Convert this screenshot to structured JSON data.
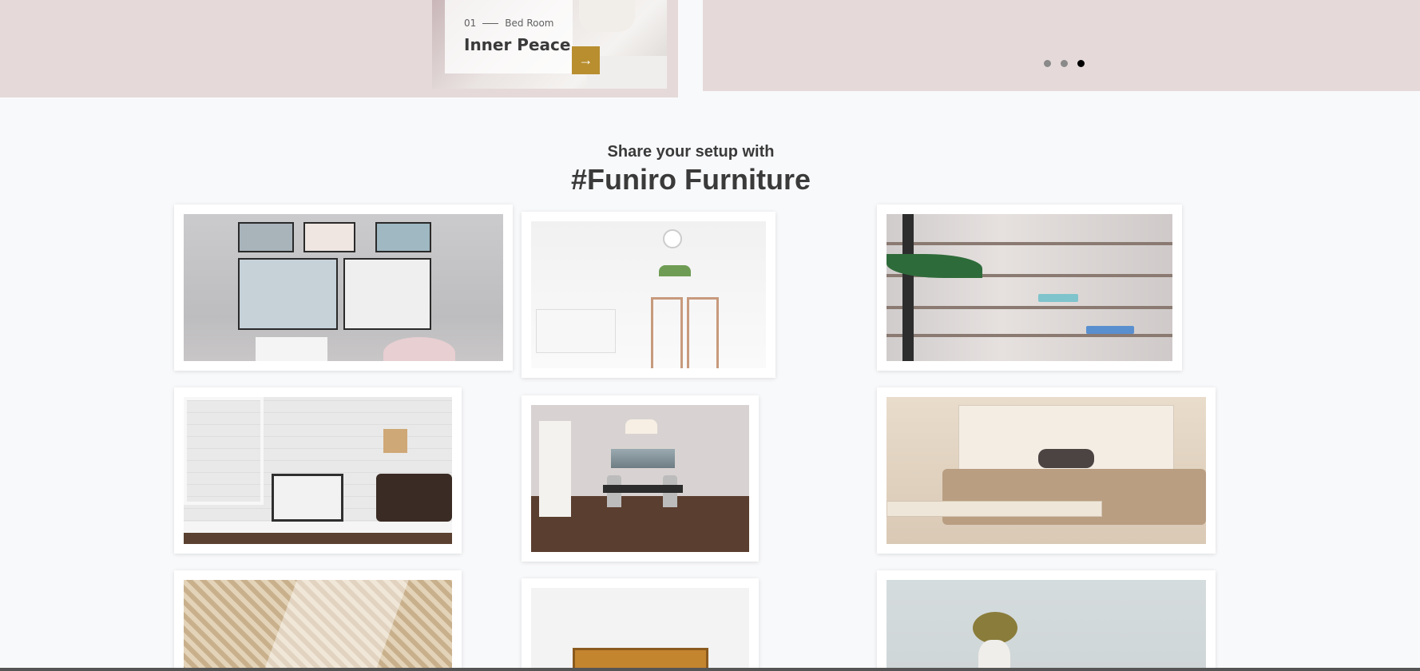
{
  "hero": {
    "slide": {
      "number": "01",
      "category": "Bed Room",
      "title": "Inner Peace",
      "arrow_icon": "→"
    },
    "dots": {
      "count": 3,
      "active_index": 2
    }
  },
  "share": {
    "subtitle": "Share your setup with",
    "title": "#Funiro Furniture"
  },
  "gallery": {
    "tiles": [
      {
        "name": "wall-frames-photo"
      },
      {
        "name": "white-dining-room-photo"
      },
      {
        "name": "shelves-photo"
      },
      {
        "name": "desk-laptop-photo"
      },
      {
        "name": "dining-room-photo"
      },
      {
        "name": "bedroom-photo"
      },
      {
        "name": "woven-texture-photo"
      },
      {
        "name": "cabinet-photo"
      },
      {
        "name": "vase-photo"
      }
    ]
  },
  "colors": {
    "hero_bg": "#e5dad9",
    "accent": "#b88e2f",
    "heading": "#3a3a3a",
    "page_bg": "#f8f9fb"
  }
}
